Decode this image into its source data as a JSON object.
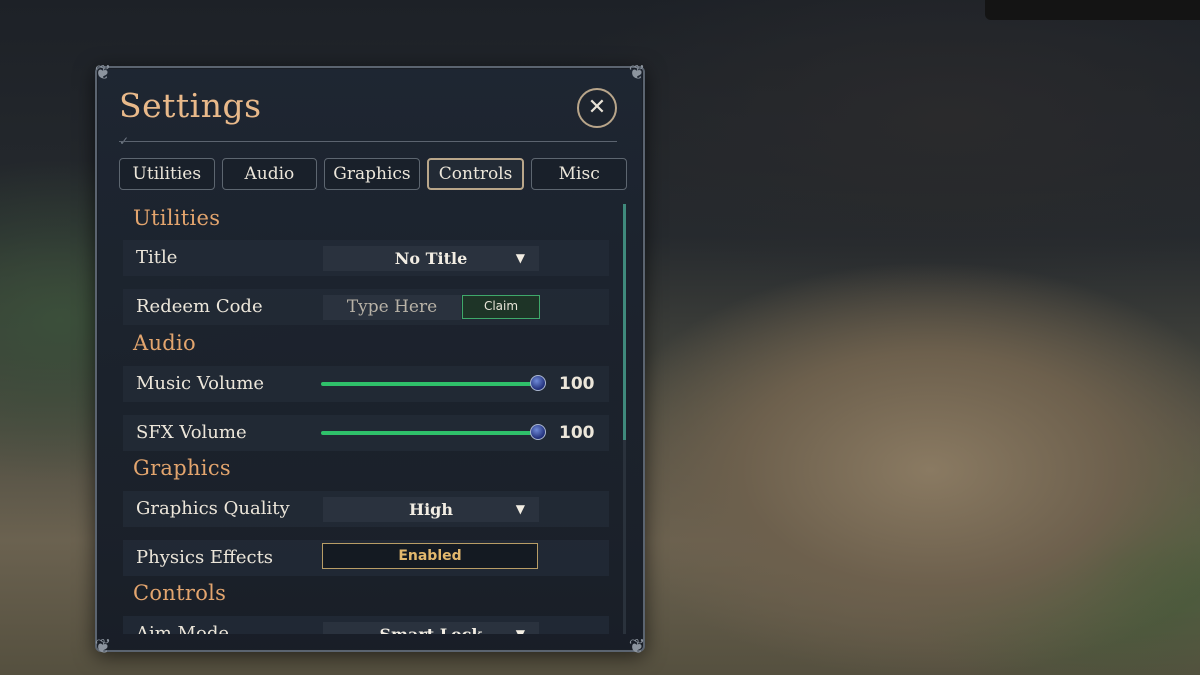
{
  "window": {
    "title": "Settings",
    "close_symbol": "✕"
  },
  "tabs": [
    {
      "label": "Utilities"
    },
    {
      "label": "Audio"
    },
    {
      "label": "Graphics"
    },
    {
      "label": "Controls",
      "active": true
    },
    {
      "label": "Misc"
    }
  ],
  "sections": {
    "utilities": {
      "heading": "Utilities",
      "title_row": {
        "label": "Title",
        "value": "No Title"
      },
      "redeem_row": {
        "label": "Redeem Code",
        "placeholder": "Type Here",
        "button": "Claim"
      }
    },
    "audio": {
      "heading": "Audio",
      "music": {
        "label": "Music Volume",
        "value": "100",
        "level": 1.0
      },
      "sfx": {
        "label": "SFX Volume",
        "value": "100",
        "level": 1.0
      }
    },
    "graphics": {
      "heading": "Graphics",
      "quality": {
        "label": "Graphics Quality",
        "value": "High"
      },
      "physics": {
        "label": "Physics Effects",
        "value": "Enabled"
      }
    },
    "controls": {
      "heading": "Controls",
      "aim": {
        "label": "Aim Mode",
        "value": "Smart Lock"
      }
    }
  },
  "icons": {
    "close": "close-icon",
    "dropdown": "chevron-down-icon"
  },
  "colors": {
    "heading": "#e3a56e",
    "title": "#e9b98a",
    "slider": "#2fc06a",
    "enabled_text": "#e3b86d"
  }
}
